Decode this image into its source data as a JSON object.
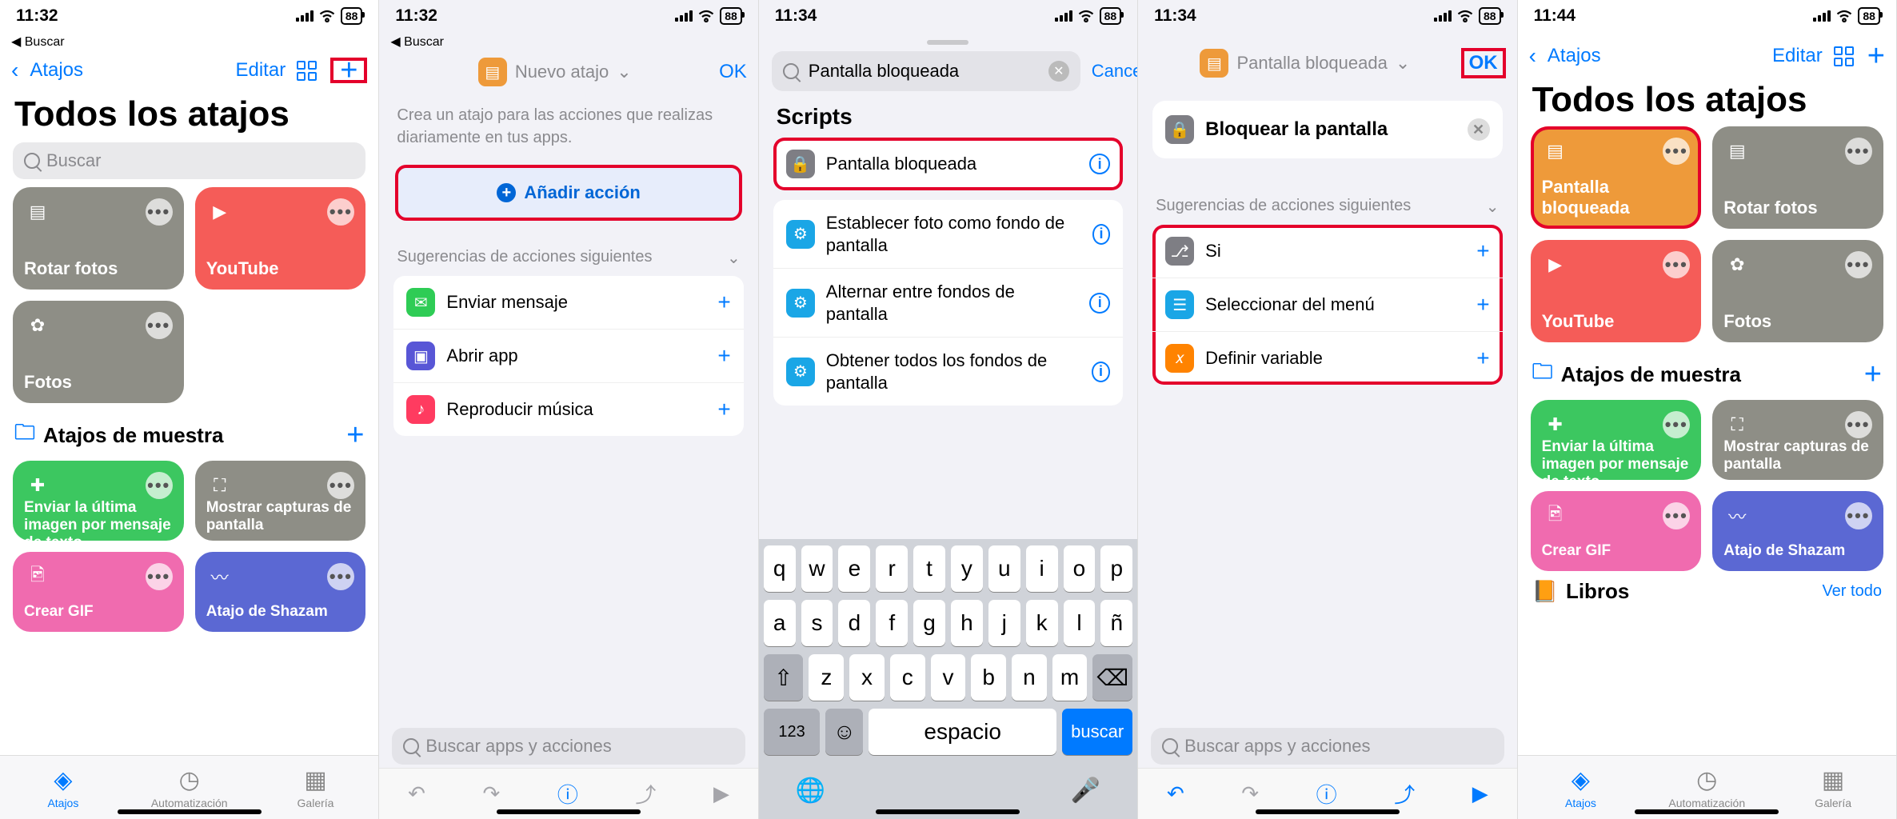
{
  "status": {
    "battery": "88"
  },
  "screens": [
    {
      "time": "11:32",
      "back_small": "◀ Buscar",
      "nav_back": "Atajos",
      "edit": "Editar",
      "title": "Todos los atajos",
      "search_ph": "Buscar",
      "tiles": [
        {
          "label": "Rotar fotos",
          "color": "#8e8e86",
          "icon": "layers"
        },
        {
          "label": "YouTube",
          "color": "#f55c58",
          "icon": "youtube"
        },
        {
          "label": "Fotos",
          "color": "#8e8e86",
          "icon": "photos"
        }
      ],
      "section": "Atajos de muestra",
      "sample_tiles": [
        {
          "label": "Enviar la última imagen por mensaje de texto",
          "color": "#3cc760",
          "icon": "plus-bubble"
        },
        {
          "label": "Mostrar capturas de pantalla",
          "color": "#8e8e86",
          "icon": "capture"
        },
        {
          "label": "Crear GIF",
          "color": "#f06baf",
          "icon": "images"
        },
        {
          "label": "Atajo de Shazam",
          "color": "#5b68d3",
          "icon": "wave"
        }
      ],
      "tabs": [
        "Atajos",
        "Automatización",
        "Galería"
      ]
    },
    {
      "time": "11:32",
      "back_small": "◀ Buscar",
      "title": "Nuevo atajo",
      "ok": "OK",
      "desc": "Crea un atajo para las acciones que realizas diariamente en tus apps.",
      "add_action": "Añadir acción",
      "sug_title": "Sugerencias de acciones siguientes",
      "sugs": [
        {
          "label": "Enviar mensaje",
          "color": "#2ecc55",
          "ic": "msg"
        },
        {
          "label": "Abrir app",
          "color": "#5856d6",
          "ic": "app"
        },
        {
          "label": "Reproducir música",
          "color": "#ff3b60",
          "ic": "music"
        }
      ],
      "search_ph": "Buscar apps y acciones"
    },
    {
      "time": "11:34",
      "search_val": "Pantalla bloqueada",
      "cancel": "Cancelar",
      "section": "Scripts",
      "rows": [
        {
          "label": "Pantalla bloqueada",
          "color": "#7e7e84",
          "ic": "lock"
        },
        {
          "label": "Establecer foto como fondo de pantalla",
          "color": "#1aa6e6",
          "ic": "gear"
        },
        {
          "label": "Alternar entre fondos de pantalla",
          "color": "#1aa6e6",
          "ic": "gear"
        },
        {
          "label": "Obtener todos los fondos de pantalla",
          "color": "#1aa6e6",
          "ic": "gear"
        }
      ],
      "kb": {
        "r1": [
          "q",
          "w",
          "e",
          "r",
          "t",
          "y",
          "u",
          "i",
          "o",
          "p"
        ],
        "r2": [
          "a",
          "s",
          "d",
          "f",
          "g",
          "h",
          "j",
          "k",
          "l",
          "ñ"
        ],
        "r3": [
          "z",
          "x",
          "c",
          "v",
          "b",
          "n",
          "m"
        ],
        "num": "123",
        "space": "espacio",
        "search": "buscar"
      }
    },
    {
      "time": "11:34",
      "title": "Pantalla bloqueada",
      "ok": "OK",
      "action": "Bloquear la pantalla",
      "sug_title": "Sugerencias de acciones siguientes",
      "sugs": [
        {
          "label": "Si",
          "color": "#7e7e84",
          "ic": "branch"
        },
        {
          "label": "Seleccionar del menú",
          "color": "#1aa6e6",
          "ic": "menu"
        },
        {
          "label": "Definir variable",
          "color": "#ff8300",
          "ic": "var"
        }
      ],
      "search_ph": "Buscar apps y acciones"
    },
    {
      "time": "11:44",
      "nav_back": "Atajos",
      "edit": "Editar",
      "title": "Todos los atajos",
      "tiles": [
        {
          "label": "Pantalla bloqueada",
          "color": "#ee9a3a",
          "icon": "layers"
        },
        {
          "label": "Rotar fotos",
          "color": "#8e8e86",
          "icon": "layers"
        },
        {
          "label": "YouTube",
          "color": "#f55c58",
          "icon": "youtube"
        },
        {
          "label": "Fotos",
          "color": "#8e8e86",
          "icon": "photos"
        }
      ],
      "section": "Atajos de muestra",
      "sample_tiles": [
        {
          "label": "Enviar la última imagen por mensaje de texto",
          "color": "#3cc760",
          "icon": "plus-bubble"
        },
        {
          "label": "Mostrar capturas de pantalla",
          "color": "#8e8e86",
          "icon": "capture"
        },
        {
          "label": "Crear GIF",
          "color": "#f06baf",
          "icon": "images"
        },
        {
          "label": "Atajo de Shazam",
          "color": "#5b68d3",
          "icon": "wave"
        }
      ],
      "book_section": "Libros",
      "see_all": "Ver todo",
      "tabs": [
        "Atajos",
        "Automatización",
        "Galería"
      ]
    }
  ]
}
